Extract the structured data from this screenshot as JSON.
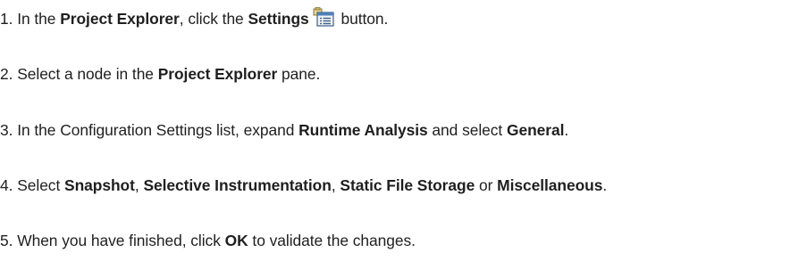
{
  "steps": [
    {
      "number": "1.",
      "pre": "In the ",
      "b1": "Project Explorer",
      "mid": ", click the ",
      "b2": "Settings",
      "post": " button.",
      "icon": "settings-icon"
    },
    {
      "number": "2.",
      "pre": "Select a node in the ",
      "b1": "Project Explorer",
      "post": " pane."
    },
    {
      "number": "3.",
      "pre": "In the Configuration Settings list, expand ",
      "b1": "Runtime Analysis",
      "mid": " and select ",
      "b2": "General",
      "post": "."
    },
    {
      "number": "4.",
      "pre": "Select ",
      "b1": "Snapshot",
      "sep1": ", ",
      "b2": "Selective Instrumentation",
      "sep2": ", ",
      "b3": "Static File Storage",
      "sep3": " or ",
      "b4": "Miscellaneous",
      "post": "."
    },
    {
      "number": "5.",
      "pre": "When you have finished, click ",
      "b1": "OK",
      "post": " to validate the changes."
    }
  ]
}
